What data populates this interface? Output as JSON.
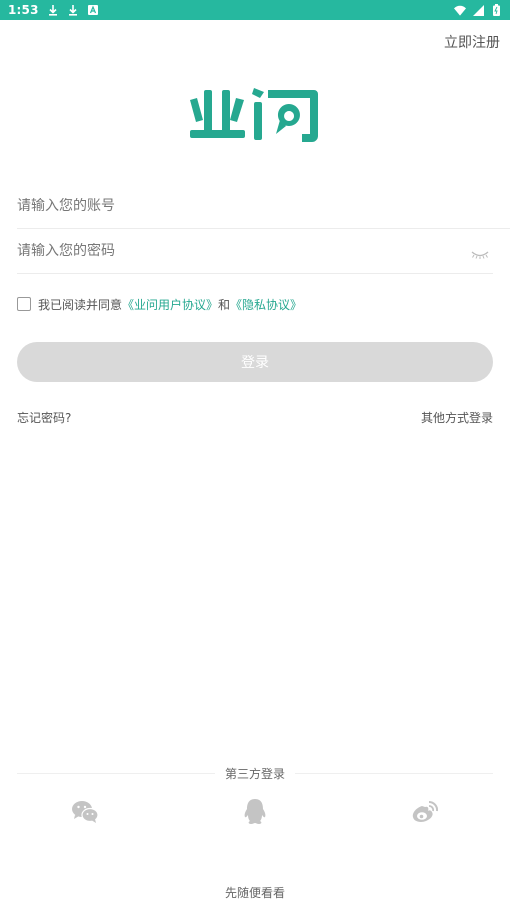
{
  "status_bar": {
    "time": "1:53"
  },
  "header": {
    "register_label": "立即注册"
  },
  "form": {
    "account_placeholder": "请输入您的账号",
    "password_placeholder": "请输入您的密码",
    "agree_prefix": "我已阅读并同意",
    "user_agreement": "《业问用户协议》",
    "agree_and": "和",
    "privacy_agreement": "《隐私协议》",
    "login_label": "登录",
    "forgot_label": "忘记密码?",
    "other_login_label": "其他方式登录"
  },
  "third_party": {
    "title": "第三方登录",
    "items": [
      {
        "icon": "wechat-icon"
      },
      {
        "icon": "qq-icon"
      },
      {
        "icon": "weibo-icon"
      }
    ]
  },
  "footer": {
    "browse_label": "先随便看看"
  },
  "colors": {
    "status_bar": "#26b89f",
    "brand": "#26a890",
    "button_disabled": "#d9d9d9"
  }
}
